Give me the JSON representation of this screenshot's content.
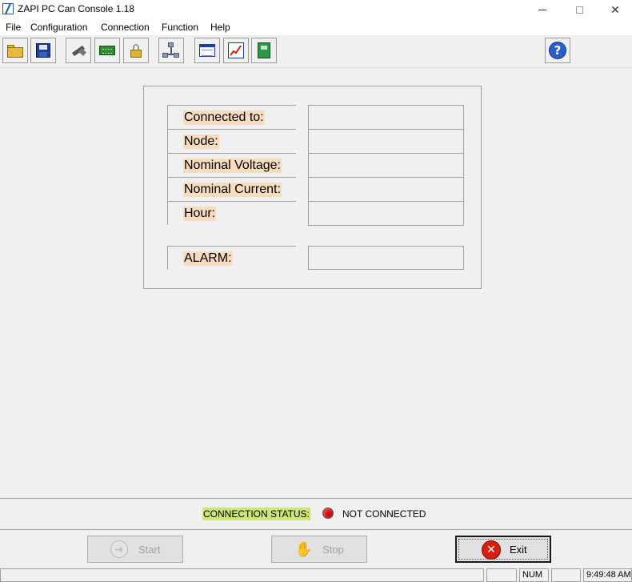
{
  "window": {
    "title": "ZAPI PC Can Console 1.18",
    "minimize_glyph": "",
    "close_glyph": "✕"
  },
  "menu": [
    "File",
    "Configuration",
    "Connection",
    "Function",
    "Help"
  ],
  "toolbar": {
    "icons": [
      "open-folder-icon",
      "save-disk-icon",
      "disconnect-plug-icon",
      "controller-board-icon",
      "lock-icon",
      "network-nodes-icon",
      "window-panel-icon",
      "graph-chart-icon",
      "green-book-icon",
      "help-icon"
    ],
    "help_glyph": "?"
  },
  "info": {
    "rows": [
      {
        "label": "Connected to:",
        "value": ""
      },
      {
        "label": "Node:",
        "value": ""
      },
      {
        "label": "Nominal Voltage:",
        "value": ""
      },
      {
        "label": "Nominal Current:",
        "value": ""
      },
      {
        "label": "Hour:",
        "value": ""
      }
    ],
    "alarm": {
      "label": "ALARM:",
      "value": ""
    }
  },
  "connection": {
    "label": "CONNECTION STATUS:",
    "status": "NOT CONNECTED",
    "indicator_color": "#cc1010"
  },
  "buttons": {
    "start": "Start",
    "stop": "Stop",
    "exit": "Exit",
    "start_glyph": "➜",
    "stop_glyph": "✋",
    "exit_glyph": "✕"
  },
  "statusbar": {
    "message": "",
    "num": "NUM",
    "time": "9:49:48 AM"
  }
}
